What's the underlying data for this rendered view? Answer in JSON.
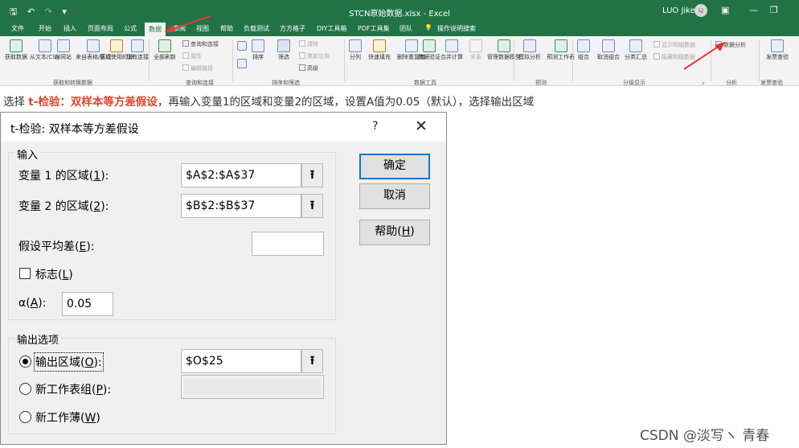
{
  "titlebar": {
    "doc_title": "STCN原始数据.xlsx - Excel",
    "user": "LUO Jike",
    "avatar": "LJ",
    "qat_icons": [
      "save-icon",
      "undo-icon",
      "redo-icon",
      "customize-icon"
    ]
  },
  "ribbon_tabs": [
    "文件",
    "开始",
    "插入",
    "页面布局",
    "公式",
    "数据",
    "审阅",
    "视图",
    "帮助",
    "负载测试",
    "方方格子",
    "DIY工具箱",
    "PDF工具集",
    "团队",
    "操作说明搜索"
  ],
  "active_tab": "数据",
  "ribbon": {
    "get_data": {
      "group_label": "获取和转换数据",
      "buttons": [
        "获取数据",
        "从文本/CSV",
        "自网站",
        "来自表格/区域",
        "最近使用的源",
        "现有连接"
      ]
    },
    "queries": {
      "group_label": "查询和连接",
      "refresh_all": "全部刷新",
      "items": [
        "查询和连接",
        "属性",
        "编辑链接"
      ]
    },
    "sort_filter": {
      "group_label": "排序和筛选",
      "sort": "排序",
      "filter": "筛选",
      "items": [
        "清除",
        "重新应用",
        "高级"
      ]
    },
    "data_tools": {
      "group_label": "数据工具",
      "buttons": [
        "分列",
        "快速填充",
        "删除重复值",
        "数据验证",
        "合并计算",
        "关系",
        "管理数据模型"
      ]
    },
    "forecast": {
      "group_label": "预测",
      "buttons": [
        "模拟分析",
        "预测工作表"
      ]
    },
    "outline": {
      "group_label": "分级显示",
      "buttons": [
        "组合",
        "取消组合",
        "分类汇总"
      ],
      "items": [
        "显示明细数据",
        "隐藏明细数据"
      ]
    },
    "analysis": {
      "group_label": "分析",
      "data_analysis": "数据分析"
    },
    "invoice": {
      "group_label": "发票查验",
      "button": "发票查验"
    }
  },
  "instruction": {
    "prefix": "选择 ",
    "highlight": "t-检验：双样本等方差假设",
    "suffix": "，再输入变量1的区域和变量2的区域，设置A值为0.05（默认），选择输出区域"
  },
  "dialog": {
    "title": "t-检验: 双样本等方差假设",
    "help_symbol": "?",
    "close_symbol": "✕",
    "input_section": {
      "legend": "输入",
      "var1_label": "变量 1 的区域(",
      "var1_key": "1",
      "var1_value": "$A$2:$A$37",
      "var2_label": "变量 2 的区域(",
      "var2_key": "2",
      "var2_value": "$B$2:$B$37",
      "hyp_label": "假设平均差(",
      "hyp_key": "E",
      "hyp_value": "",
      "labels_label": "标志(",
      "labels_key": "L",
      "labels_checked": false,
      "alpha_label": "α(",
      "alpha_key": "A",
      "alpha_value": "0.05"
    },
    "output_section": {
      "legend": "输出选项",
      "output_range_label": "输出区域(",
      "output_range_key": "O",
      "output_range_value": "$O$25",
      "new_sheet_label": "新工作表组(",
      "new_sheet_key": "P",
      "new_workbook_label": "新工作薄(",
      "new_workbook_key": "W",
      "selected": "output_range"
    },
    "buttons": {
      "ok": "确定",
      "cancel": "取消",
      "help_prefix": "帮助(",
      "help_key": "H"
    },
    "ref_button_symbol": "⭱",
    "trailing_colon": "):",
    "trailing_paren": ")"
  },
  "watermark": "CSDN @淡写ヽ 青春",
  "colors": {
    "excel_green": "#217346",
    "highlight_red": "#e0452d",
    "arrow_red": "#e53935",
    "default_button_border": "#0078d7"
  }
}
